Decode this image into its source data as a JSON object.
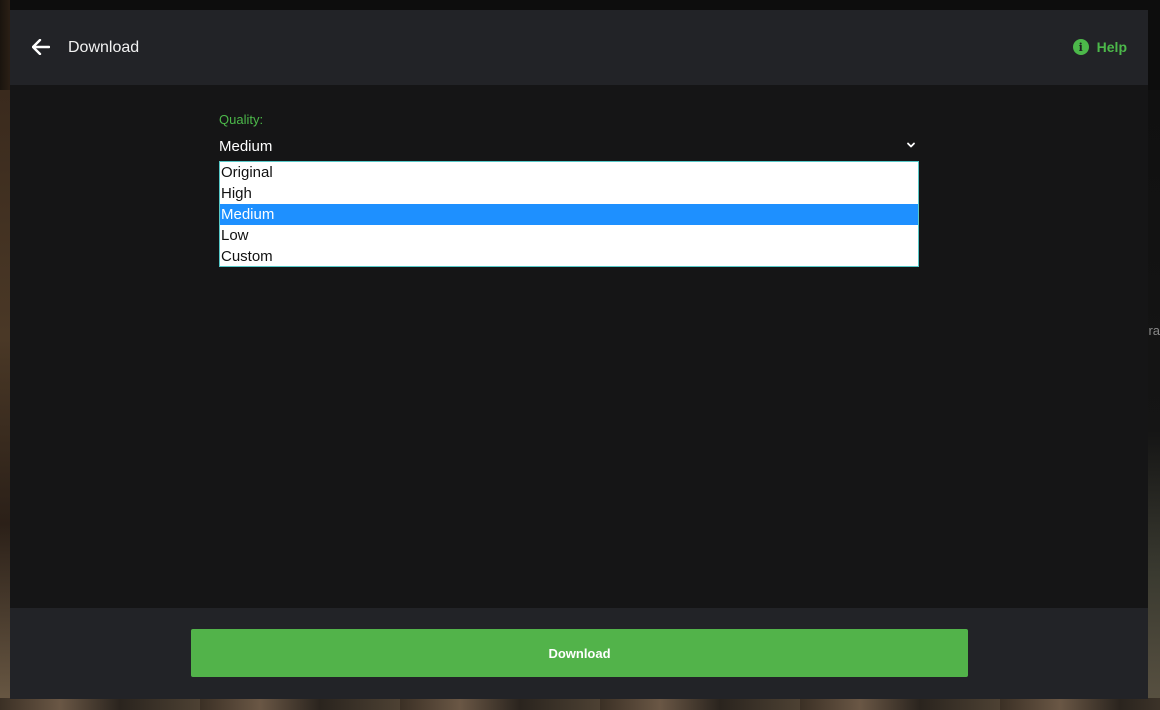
{
  "header": {
    "title": "Download",
    "back_icon": "arrow-left-icon",
    "help_label": "Help",
    "help_icon": "info-icon"
  },
  "background": {
    "edge_text": "ra"
  },
  "quality": {
    "label": "Quality:",
    "selected": "Medium",
    "options": [
      "Original",
      "High",
      "Medium",
      "Low",
      "Custom"
    ],
    "chevron_icon": "chevron-down-icon"
  },
  "footer": {
    "download_label": "Download"
  },
  "colors": {
    "accent": "#4cb84a",
    "button": "#52b34a",
    "header_bg": "#222327",
    "body_bg": "#151516",
    "selection": "#1e90ff"
  }
}
